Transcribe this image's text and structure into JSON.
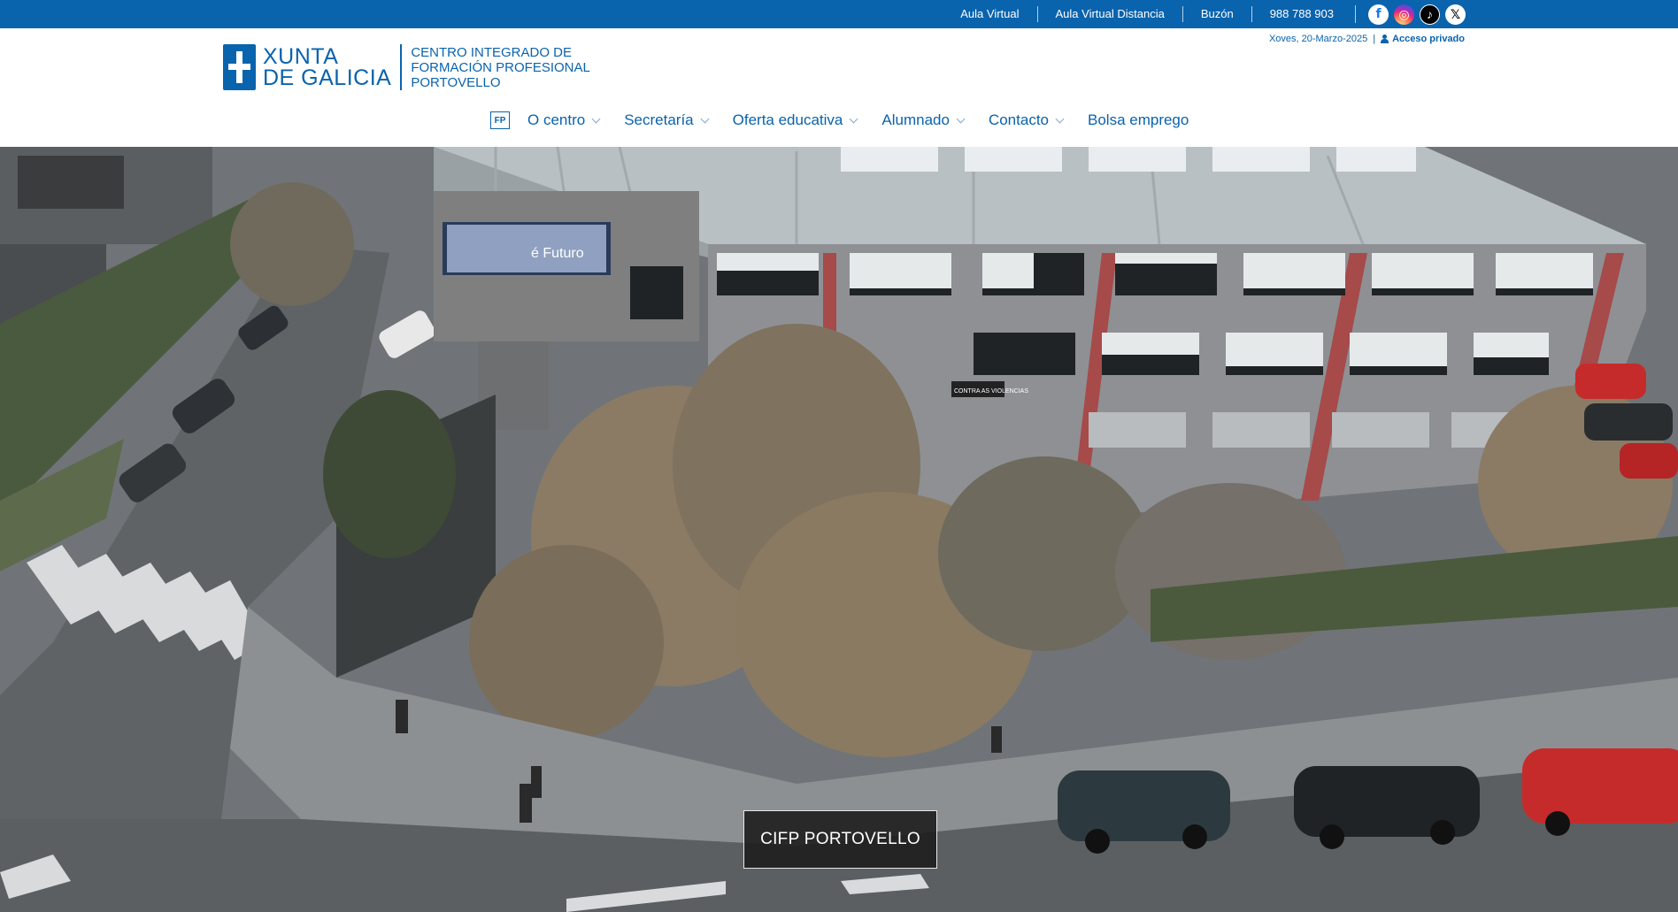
{
  "topbar": {
    "links": [
      "Aula Virtual",
      "Aula Virtual Distancia",
      "Buzón",
      "988 788 903"
    ],
    "social": [
      {
        "icon": "facebook-icon",
        "glyph": "f"
      },
      {
        "icon": "instagram-icon",
        "glyph": "◎"
      },
      {
        "icon": "tiktok-icon",
        "glyph": "♪"
      },
      {
        "icon": "x-twitter-icon",
        "glyph": "𝕏"
      }
    ],
    "color": "#0a63ad"
  },
  "header": {
    "logo_line1": "XUNTA",
    "logo_line2": "DE GALICIA",
    "center_line1": "CENTRO INTEGRADO DE",
    "center_line2": "FORMACIÓN PROFESIONAL",
    "center_line3": "PORTOVELLO",
    "date": "Xoves, 20-Marzo-2025",
    "separator": "|",
    "private_access": "Acceso privado"
  },
  "nav": {
    "fp_icon": "FP",
    "items": [
      {
        "label": "O centro",
        "dropdown": true
      },
      {
        "label": "Secretaría",
        "dropdown": true
      },
      {
        "label": "Oferta educativa",
        "dropdown": true
      },
      {
        "label": "Alumnado",
        "dropdown": true
      },
      {
        "label": "Contacto",
        "dropdown": true
      },
      {
        "label": "Bolsa emprego",
        "dropdown": false
      }
    ]
  },
  "hero": {
    "button_label": "CIFP PORTOVELLO",
    "billboard_text": "é Futuro",
    "sign_text": "CONTRA AS VIOLENCIAS"
  }
}
